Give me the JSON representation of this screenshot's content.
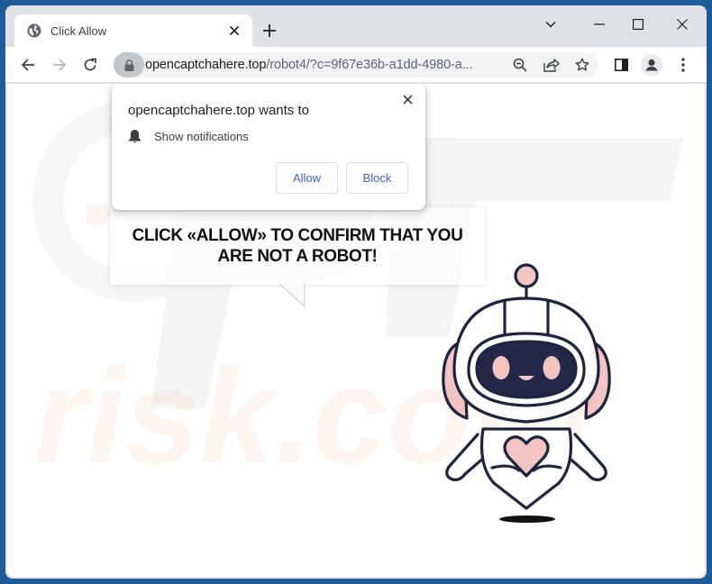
{
  "browser": {
    "tab": {
      "title": "Click Allow",
      "favicon": "globe-icon",
      "close_icon": "close-icon"
    },
    "new_tab_icon": "plus-icon",
    "window_controls": [
      "chevron-down-icon",
      "minimize-icon",
      "maximize-icon",
      "close-icon"
    ],
    "toolbar": {
      "back_icon": "arrow-left-icon",
      "forward_icon": "arrow-right-icon",
      "reload_icon": "reload-icon",
      "security_icon": "lock-icon",
      "url_domain": "opencaptchahere.top",
      "url_rest": "/robot4/?c=9f67e36b-a1dd-4980-a...",
      "omnibox_icons": [
        "zoom-out-icon",
        "share-icon",
        "star-icon"
      ],
      "side_panel_icon": "side-panel-icon",
      "profile_icon": "profile-icon",
      "menu_icon": "more-vert-icon"
    }
  },
  "permission_prompt": {
    "title": "opencaptchahere.top wants to",
    "permission_icon": "bell-icon",
    "permission_text": "Show notifications",
    "allow_label": "Allow",
    "block_label": "Block",
    "close_icon": "close-icon"
  },
  "page": {
    "message": "CLICK «ALLOW» TO CONFIRM THAT YOU ARE NOT A ROBOT!",
    "illustration": "robot-illustration",
    "watermark_text": "risk.com"
  },
  "colors": {
    "frame": "#1f5a99",
    "tabstrip": "#dee1e6",
    "button_text": "#3b5fc9",
    "robot_outline": "#1e2440",
    "robot_pink": "#f2c4c2",
    "robot_visor": "#232846"
  }
}
